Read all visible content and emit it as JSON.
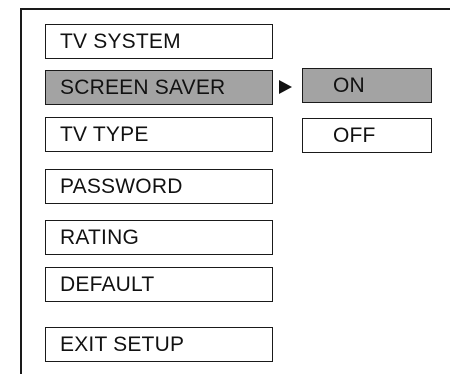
{
  "menu": {
    "items": [
      {
        "label": "TV SYSTEM",
        "selected": false
      },
      {
        "label": "SCREEN SAVER",
        "selected": true
      },
      {
        "label": "TV TYPE",
        "selected": false
      },
      {
        "label": "PASSWORD",
        "selected": false
      },
      {
        "label": "RATING",
        "selected": false
      },
      {
        "label": "DEFAULT",
        "selected": false
      },
      {
        "label": "EXIT SETUP",
        "selected": false
      }
    ]
  },
  "submenu": {
    "options": [
      {
        "label": "ON",
        "selected": true
      },
      {
        "label": "OFF",
        "selected": false
      }
    ]
  },
  "colors": {
    "selected_background": "#a3a3a3",
    "border": "#1a1a1a",
    "text": "#111111",
    "background": "#ffffff"
  },
  "icons": {
    "submenu_indicator": "right-triangle-arrow-icon"
  }
}
